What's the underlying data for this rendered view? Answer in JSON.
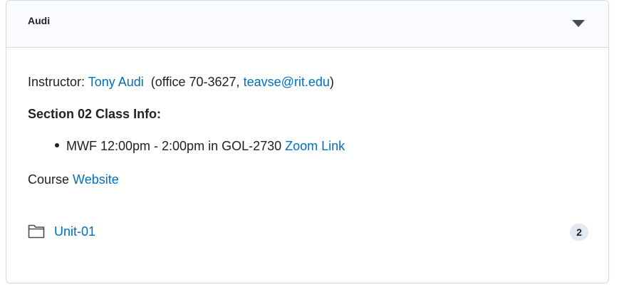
{
  "panel": {
    "title": "Audi",
    "toggle_icon": "caret-down-icon"
  },
  "instructor": {
    "label": "Instructor:",
    "name": "Tony Audi",
    "office_prefix": " (office 70-3627, ",
    "email": "teavse@rit.edu",
    "office_suffix": ")"
  },
  "section": {
    "heading": "Section 02 Class Info:",
    "items": [
      {
        "text": "MWF 12:00pm - 2:00pm in GOL-2730 ",
        "link": "Zoom Link"
      }
    ]
  },
  "course": {
    "prefix": "Course ",
    "link": "Website"
  },
  "modules": [
    {
      "icon": "folder-icon",
      "label": "Unit-01",
      "count": "2"
    }
  ],
  "colors": {
    "link": "#006fbf",
    "header_bg": "#f9fbff",
    "border": "#d3d9e3",
    "badge_bg": "#e3e9f1"
  }
}
